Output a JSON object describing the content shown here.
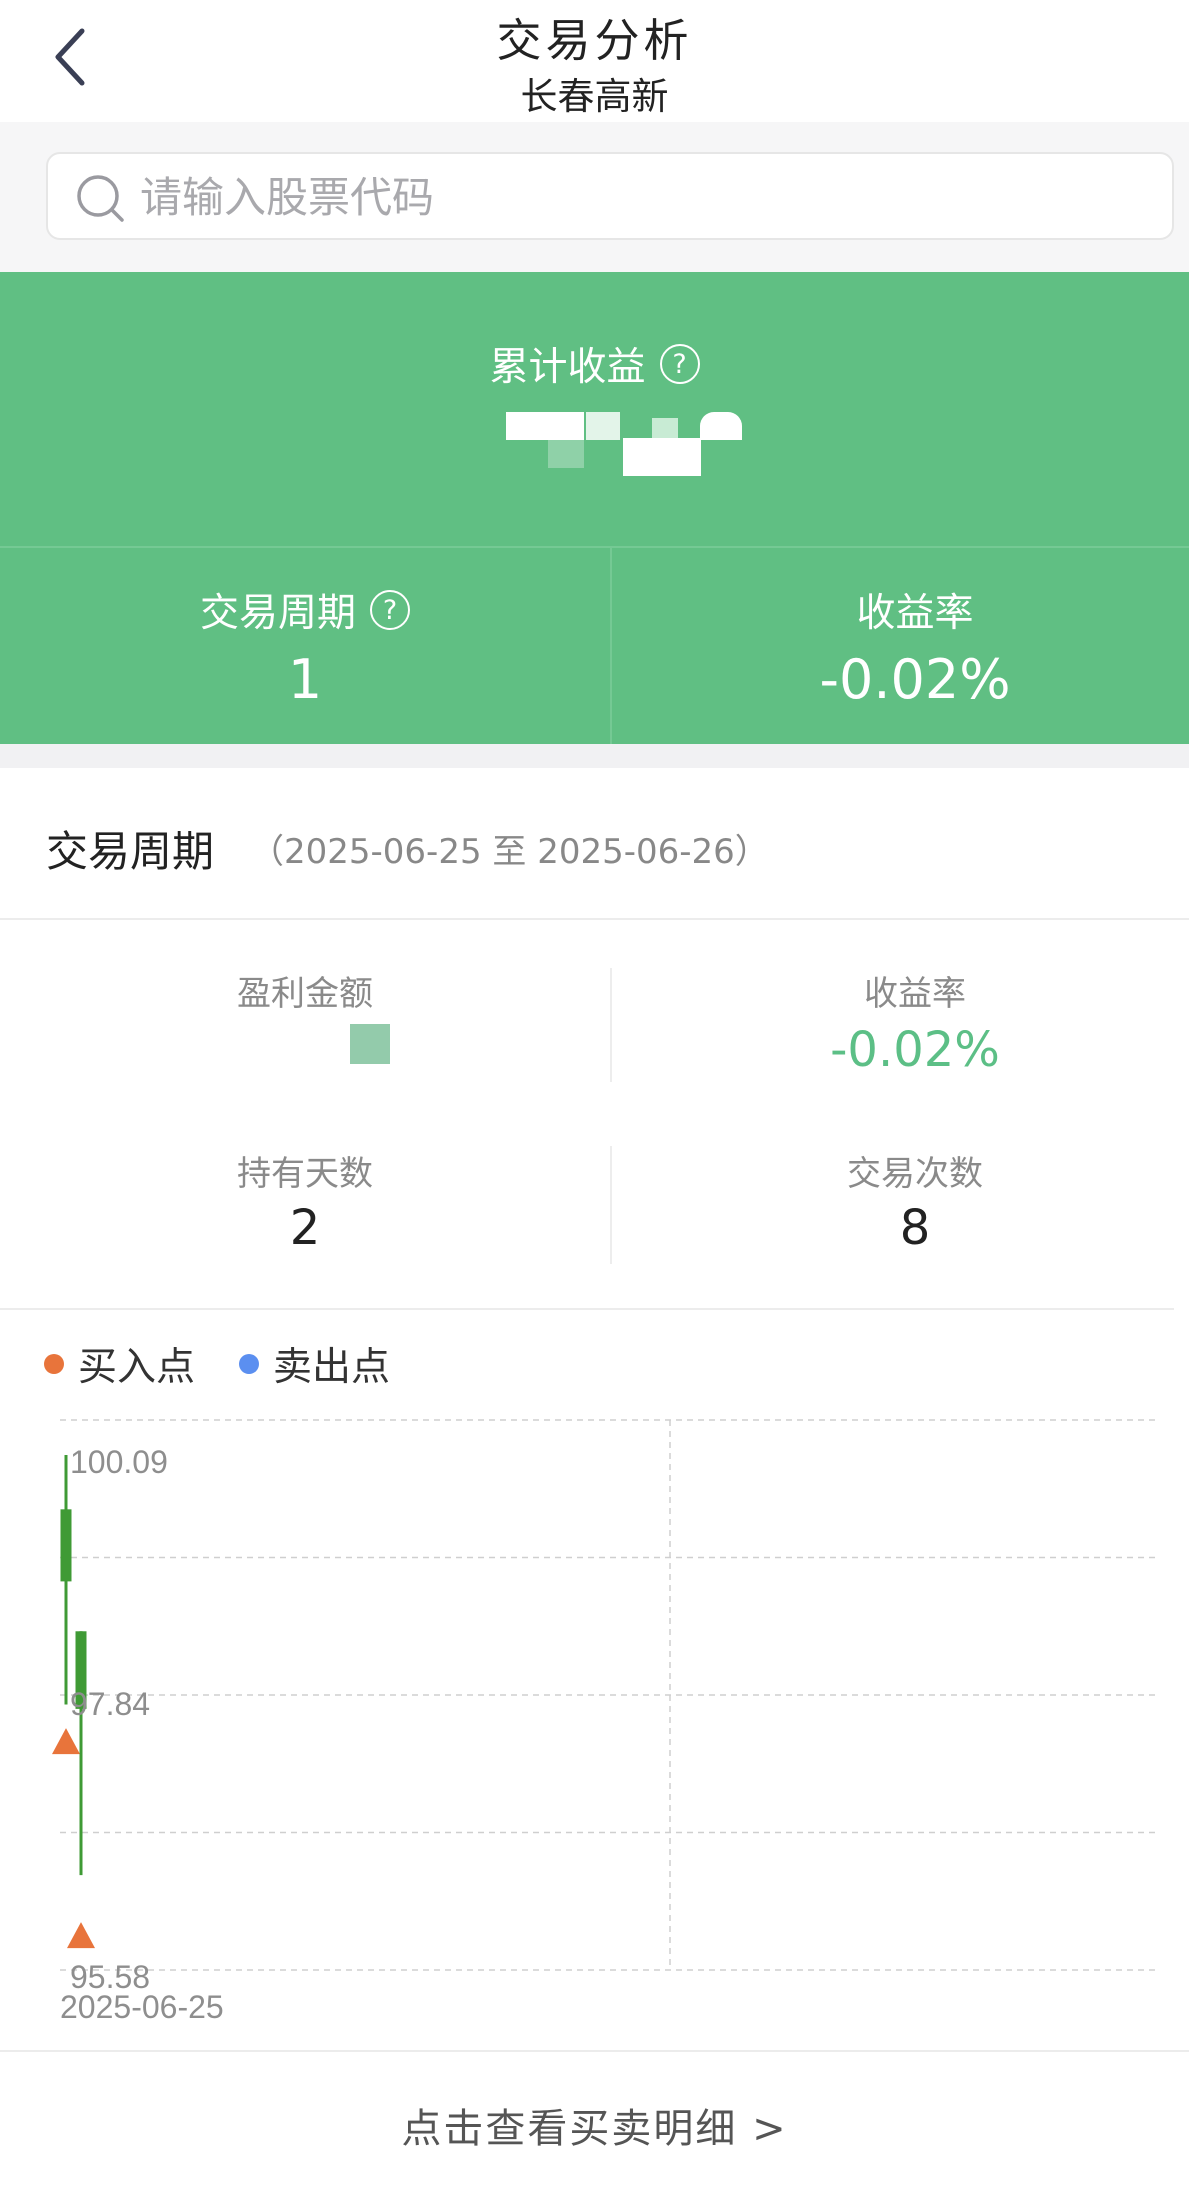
{
  "header": {
    "title": "交易分析",
    "subtitle": "长春高新"
  },
  "search": {
    "placeholder": "请输入股票代码"
  },
  "summary": {
    "cumulative_label": "累计收益",
    "period_label": "交易周期",
    "period_value": "1",
    "return_label": "收益率",
    "return_value": "-0.02%",
    "background_color": "#60bf83"
  },
  "period": {
    "title": "交易周期",
    "range": "（2025-06-25 至 2025-06-26）",
    "profit_label": "盈利金额",
    "return_label": "收益率",
    "return_value": "-0.02%",
    "hold_days_label": "持有天数",
    "hold_days_value": "2",
    "trade_count_label": "交易次数",
    "trade_count_value": "8",
    "return_color": "#5cbf86"
  },
  "legend": {
    "buy_label": "买入点",
    "sell_label": "卖出点",
    "buy_color": "#e8743b",
    "sell_color": "#5b8ff0"
  },
  "chart_data": {
    "type": "candlestick",
    "y_tick_labels": [
      "100.09",
      "97.84",
      "95.58"
    ],
    "ylim": [
      95.58,
      100.09
    ],
    "x_tick_labels": [
      "2025-06-25"
    ],
    "grid": true,
    "candles": [
      {
        "open": 99.6,
        "close": 98.95,
        "high": 100.09,
        "low": 97.84,
        "color": "#3f9a35"
      },
      {
        "open": 98.5,
        "close": 97.8,
        "high": 98.5,
        "low": 96.3,
        "color": "#3f9a35"
      }
    ],
    "buy_points": [
      {
        "candle": 0,
        "value": 97.5
      },
      {
        "candle": 1,
        "value": 95.75
      }
    ],
    "sell_points": []
  },
  "footer": {
    "detail_link": "点击查看买卖明细 >"
  }
}
